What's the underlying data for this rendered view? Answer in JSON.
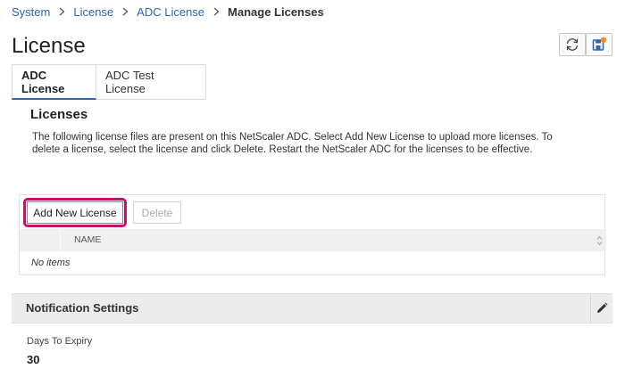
{
  "breadcrumb": {
    "items": [
      "System",
      "License",
      "ADC License"
    ],
    "current": "Manage Licenses"
  },
  "page": {
    "title": "License"
  },
  "toolbar": {
    "refresh_icon": "refresh-icon",
    "save_icon": "save-config-icon",
    "save_badge_color": "#f28c28"
  },
  "tabs": [
    {
      "label": "ADC License",
      "active": true
    },
    {
      "label": "ADC Test License",
      "active": false
    }
  ],
  "licenses": {
    "title": "Licenses",
    "description": "The following license files are present on this NetScaler ADC. Select Add New License to upload more licenses. To delete a license, select the license and click Delete. Restart the NetScaler ADC for the licenses to be effective.",
    "add_button": "Add New License",
    "delete_button": "Delete",
    "columns": [
      "NAME"
    ],
    "empty_text": "No items"
  },
  "notification": {
    "title": "Notification Settings",
    "field_label": "Days To Expiry",
    "field_value": "30"
  },
  "colors": {
    "link": "#2d63b8",
    "highlight": "#c0136a",
    "active_tab_underline": "#2d63b8"
  }
}
